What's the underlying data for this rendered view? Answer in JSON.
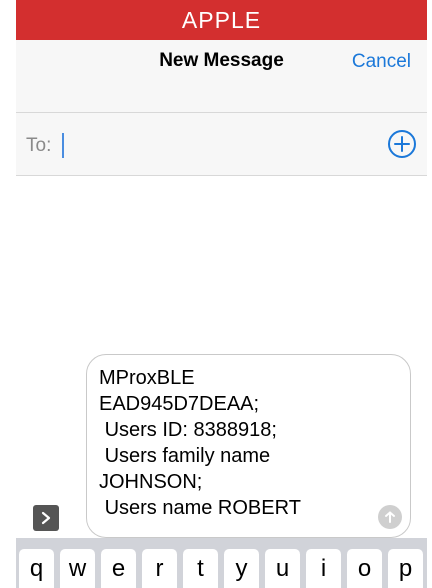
{
  "status_bar": {
    "carrier": "APPLE",
    "background_color": "#d32f2f"
  },
  "nav": {
    "title": "New Message",
    "cancel_label": "Cancel",
    "accent_color": "#1b78d9"
  },
  "recipient": {
    "label": "To:",
    "value": "",
    "add_icon": "plus-circle-icon"
  },
  "compose": {
    "apps_icon": "chevron-right-icon",
    "message": "MProxBLE\nEAD945D7DEAA;\n Users ID: 8388918;\n Users family name\nJOHNSON;\n Users name ROBERT",
    "send_icon": "arrow-up-icon"
  },
  "keyboard": {
    "keys": [
      "q",
      "w",
      "e",
      "r",
      "t",
      "y",
      "u",
      "i",
      "o",
      "p"
    ]
  }
}
